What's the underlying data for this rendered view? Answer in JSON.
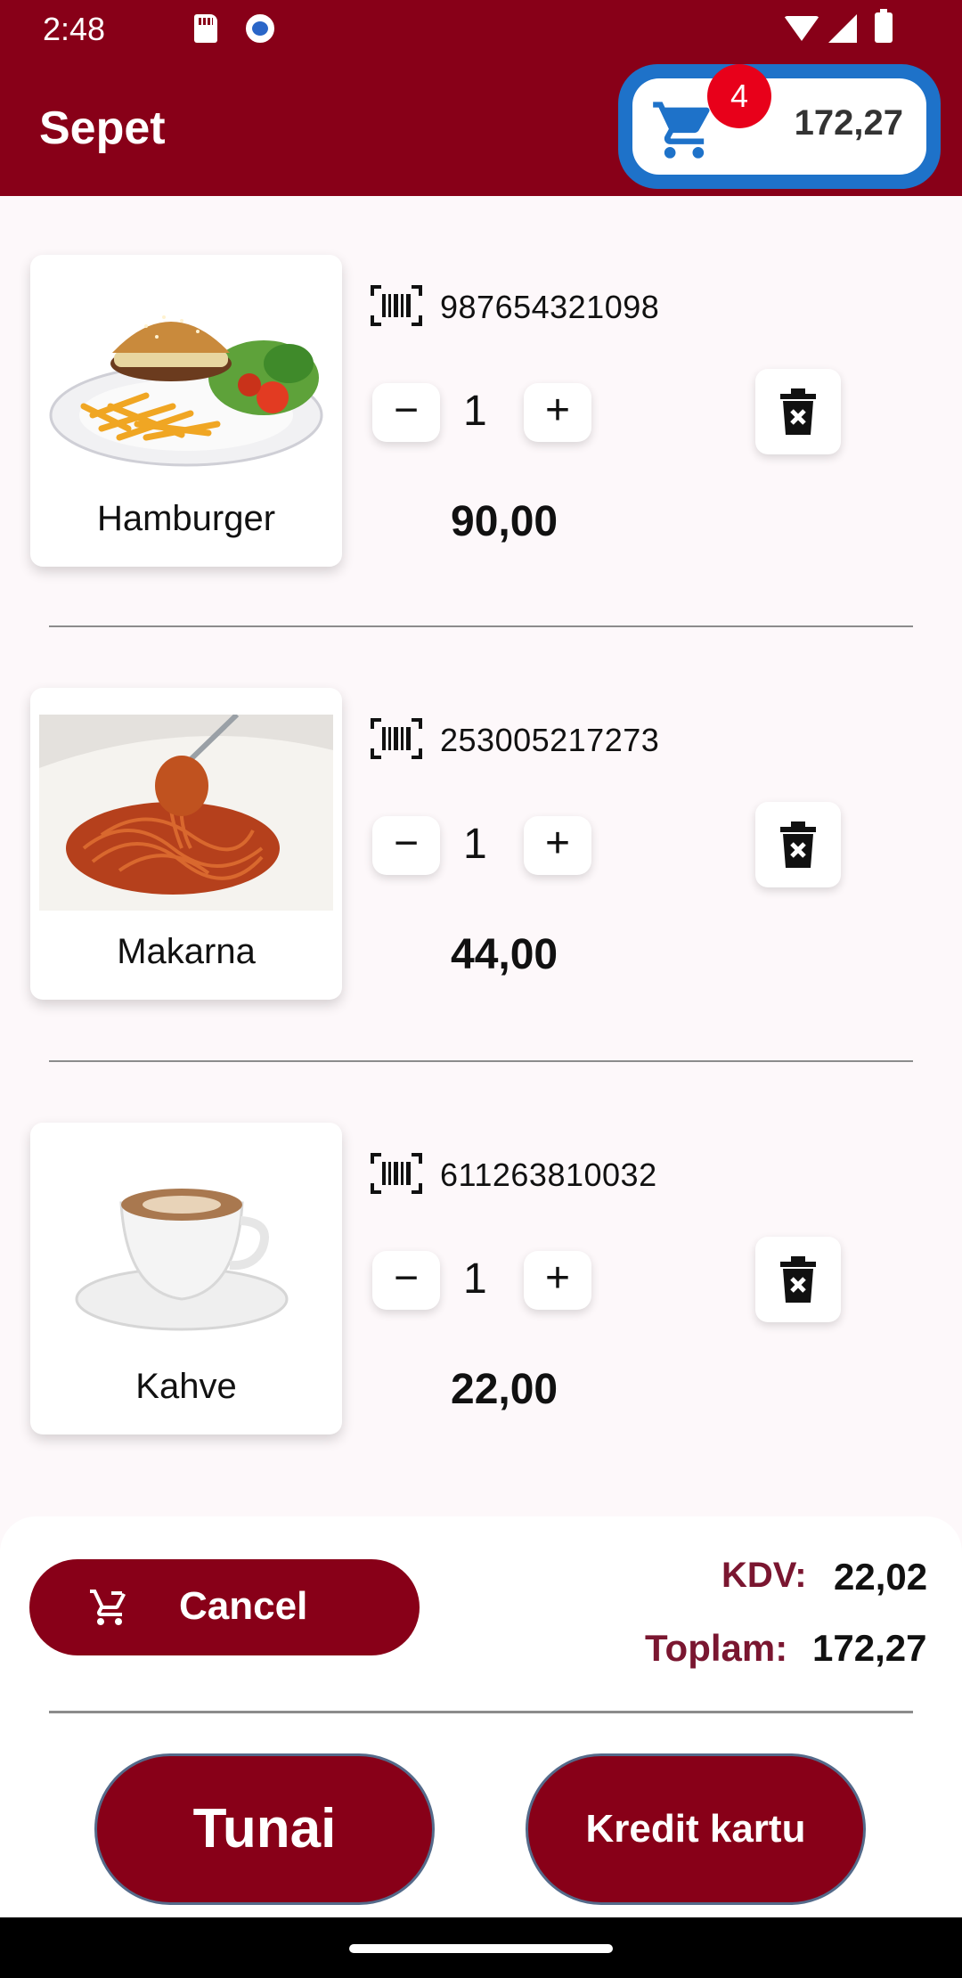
{
  "status_bar": {
    "time": "2:48"
  },
  "header": {
    "title": "Sepet",
    "cart_count": "4",
    "cart_total": "172,27"
  },
  "items": [
    {
      "name": "Hamburger",
      "barcode": "987654321098",
      "quantity": "1",
      "price": "90,00"
    },
    {
      "name": "Makarna",
      "barcode": "253005217273",
      "quantity": "1",
      "price": "44,00"
    },
    {
      "name": "Kahve",
      "barcode": "611263810032",
      "quantity": "1",
      "price": "22,00"
    }
  ],
  "controls": {
    "minus": "−",
    "plus": "+"
  },
  "summary": {
    "cancel_label": "Cancel",
    "vat_label": "KDV:",
    "vat_value": "22,02",
    "total_label": "Toplam:",
    "total_value": "172,27"
  },
  "payment": {
    "cash_label": "Tunai",
    "card_label": "Kredit kartu"
  },
  "colors": {
    "primary": "#880018",
    "cart_accent": "#1e72c9",
    "badge": "#e8001a"
  }
}
